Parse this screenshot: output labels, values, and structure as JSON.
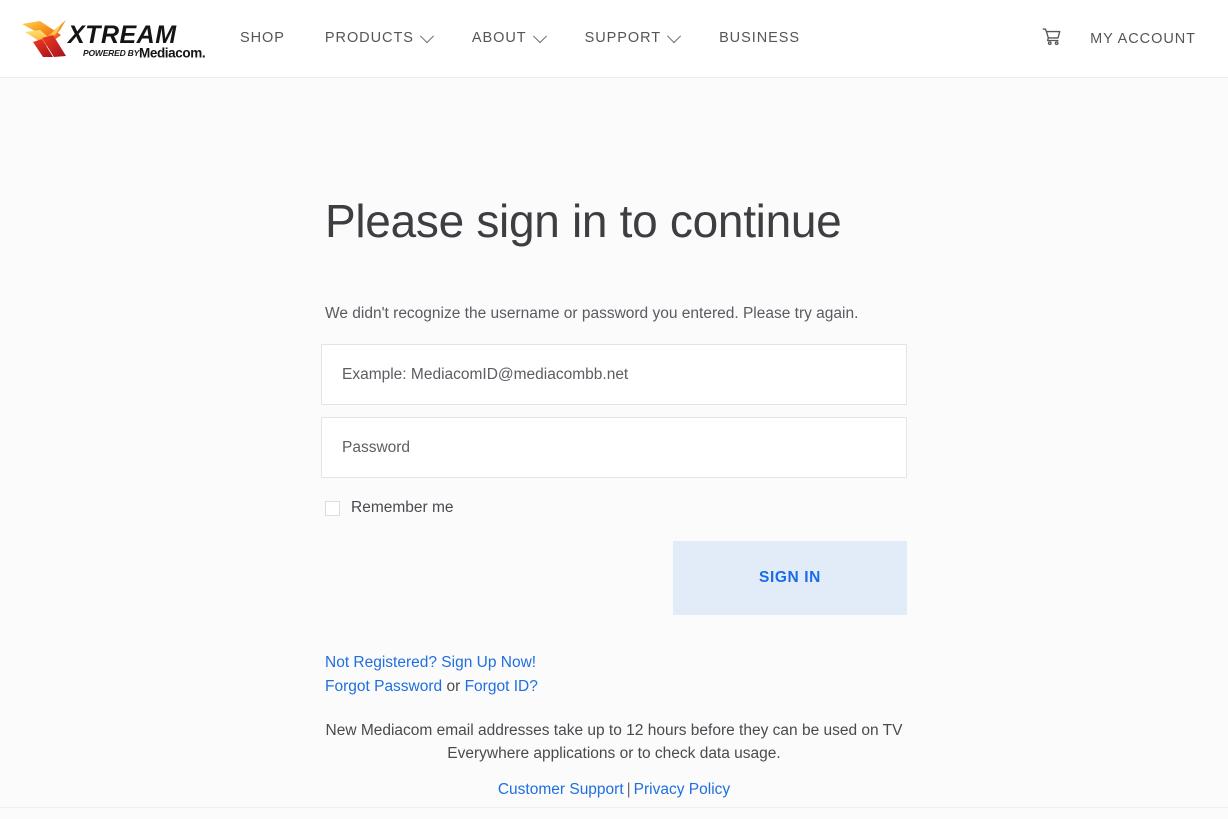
{
  "header": {
    "logo": {
      "name": "xtream-mediacom-logo",
      "wordmark": "XTREAM",
      "tagline_prefix": "POWERED BY",
      "tagline_brand": "Mediacom.",
      "colors": {
        "mark_orange": "#F6A01A",
        "mark_yellow": "#FFD24A",
        "mark_red": "#D81E20",
        "mark_crimson": "#B3121A",
        "wordmark": "#1A1A1A"
      }
    },
    "nav": [
      {
        "label": "SHOP",
        "has_dropdown": false
      },
      {
        "label": "PRODUCTS",
        "has_dropdown": true
      },
      {
        "label": "ABOUT",
        "has_dropdown": true
      },
      {
        "label": "SUPPORT",
        "has_dropdown": true
      },
      {
        "label": "BUSINESS",
        "has_dropdown": false
      }
    ],
    "cart_icon": "shopping-cart-icon",
    "account_label": "MY ACCOUNT"
  },
  "main": {
    "title": "Please sign in to continue",
    "error_message": "We didn't recognize the username or password you entered. Please try again.",
    "username": {
      "value": "",
      "placeholder": "Example: MediacomID@mediacombb.net"
    },
    "password": {
      "value": "",
      "placeholder": "Password"
    },
    "remember_me": {
      "label": "Remember me",
      "checked": false
    },
    "signin_button": "SIGN IN",
    "links": {
      "sign_up": "Not Registered? Sign Up Now!",
      "forgot_password": "Forgot Password",
      "or": "or",
      "forgot_id": "Forgot ID?"
    },
    "note": "New Mediacom email addresses take up to 12 hours before they can be used on TV Everywhere applications or to check data usage.",
    "footer_links": {
      "customer_support": "Customer Support",
      "divider": "|",
      "privacy_policy": "Privacy Policy"
    }
  },
  "theme": {
    "page_bg": "#fbfbfc",
    "header_bg": "#ffffff",
    "link_blue": "#1f6fe0",
    "button_bg": "#e2ebf8",
    "button_text": "#1b6be8"
  }
}
